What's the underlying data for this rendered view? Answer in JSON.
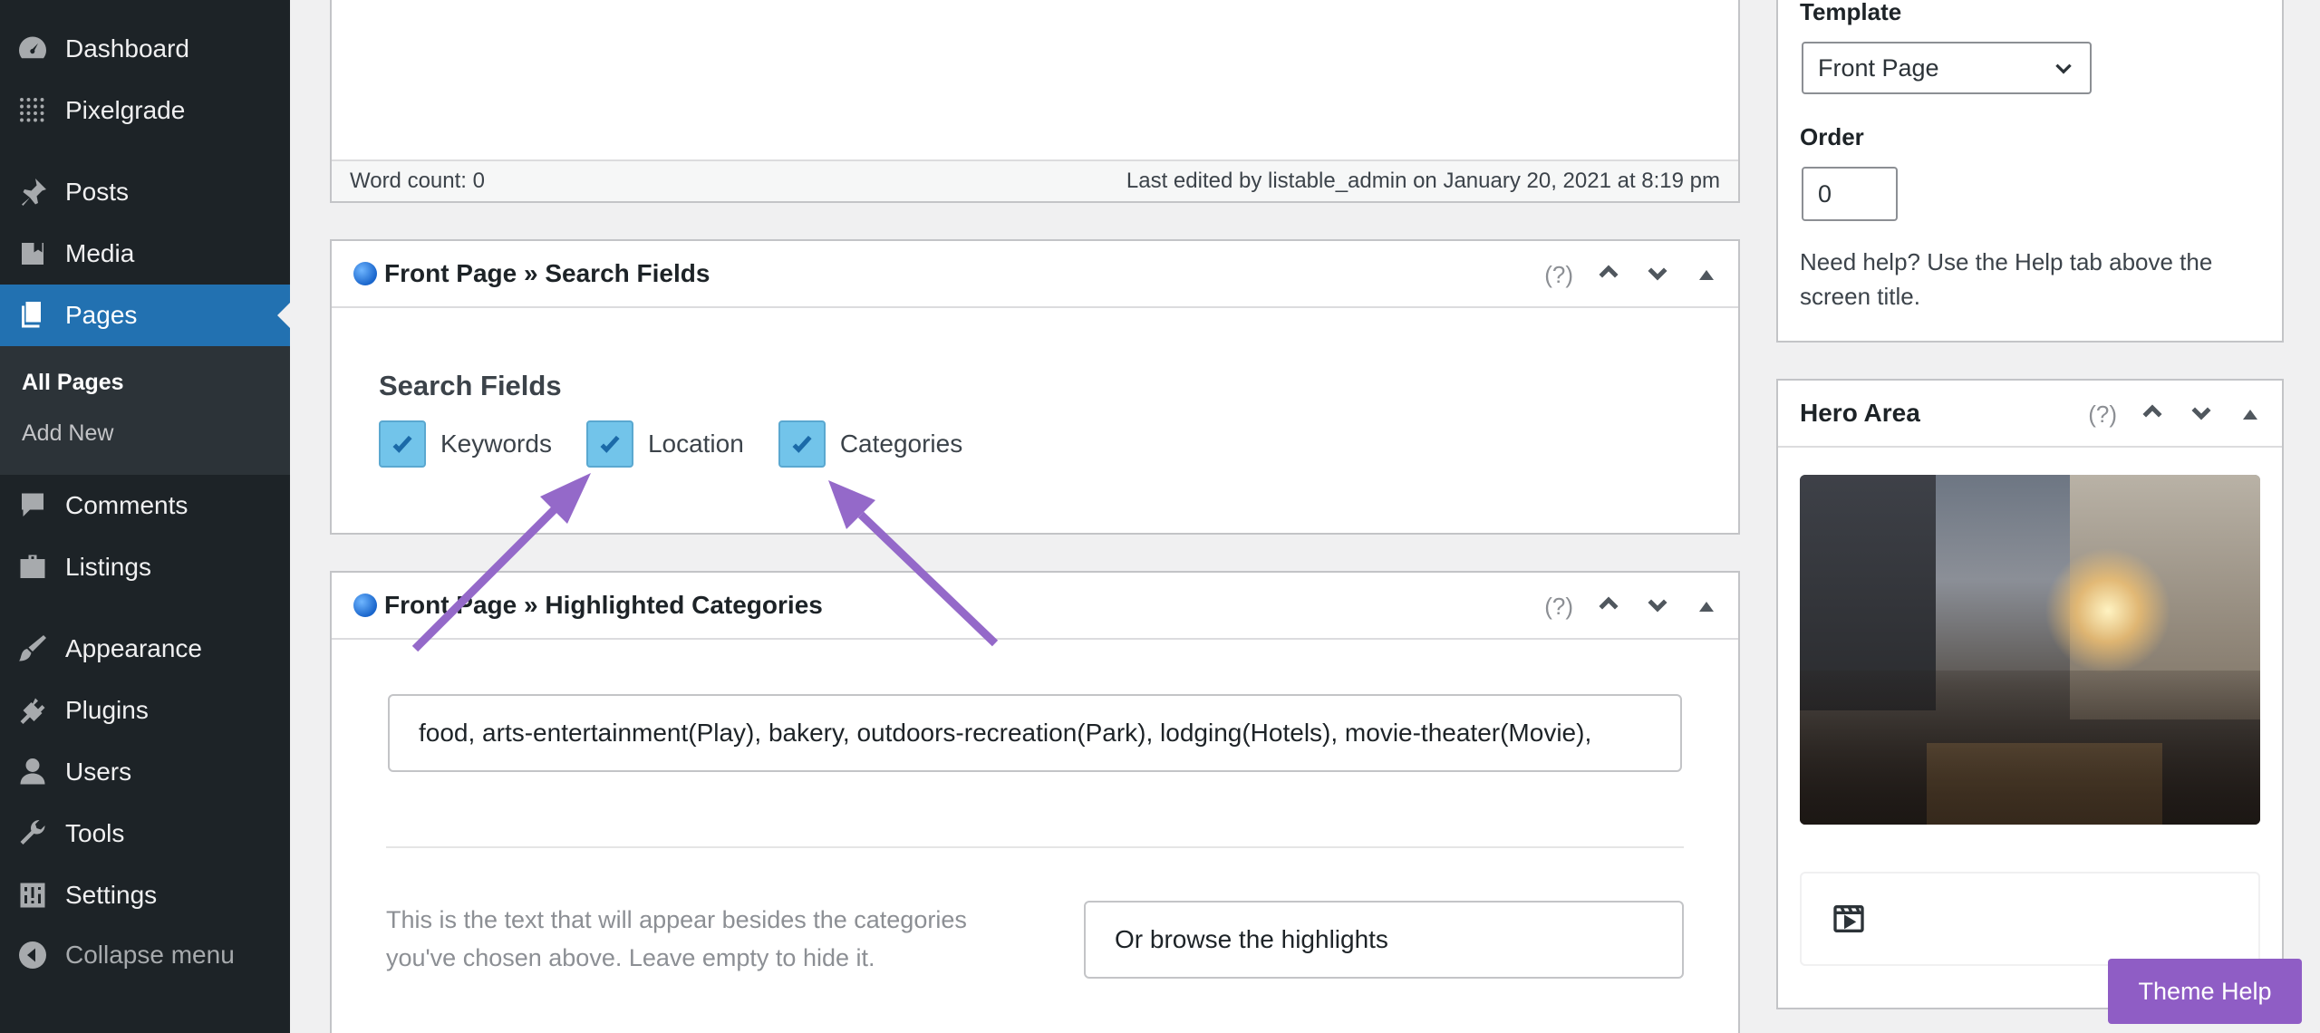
{
  "sidebar": {
    "items": [
      {
        "label": "Dashboard",
        "icon": "dashboard-icon"
      },
      {
        "label": "Pixelgrade",
        "icon": "grid-dots-icon"
      },
      {
        "label": "Posts",
        "icon": "pushpin-icon"
      },
      {
        "label": "Media",
        "icon": "media-icon"
      },
      {
        "label": "Pages",
        "icon": "pages-icon"
      },
      {
        "label": "Comments",
        "icon": "comment-icon"
      },
      {
        "label": "Listings",
        "icon": "briefcase-icon"
      },
      {
        "label": "Appearance",
        "icon": "paintbrush-icon"
      },
      {
        "label": "Plugins",
        "icon": "plug-icon"
      },
      {
        "label": "Users",
        "icon": "user-icon"
      },
      {
        "label": "Tools",
        "icon": "wrench-icon"
      },
      {
        "label": "Settings",
        "icon": "sliders-icon"
      }
    ],
    "submenu": [
      "All Pages",
      "Add New"
    ],
    "collapse_label": "Collapse menu",
    "active_color": "#2271b1"
  },
  "editor_footer": {
    "word_count": "Word count: 0",
    "last_edited": "Last edited by listable_admin on January 20, 2021 at 8:19 pm"
  },
  "search_fields_box": {
    "title": "Front Page » Search Fields",
    "help": "(?)",
    "heading": "Search Fields",
    "options": [
      {
        "label": "Keywords",
        "checked": true
      },
      {
        "label": "Location",
        "checked": true
      },
      {
        "label": "Categories",
        "checked": true
      }
    ]
  },
  "highlighted_box": {
    "title": "Front Page » Highlighted Categories",
    "help": "(?)",
    "categories_value": "food, arts-entertainment(Play), bakery, outdoors-recreation(Park), lodging(Hotels), movie-theater(Movie),",
    "description": "This is the text that will appear besides the categories you've chosen above. Leave empty to hide it.",
    "browse_value": "Or browse the highlights"
  },
  "page_attributes": {
    "template_label": "Template",
    "template_value": "Front Page",
    "order_label": "Order",
    "order_value": "0",
    "help_text": "Need help? Use the Help tab above the screen title."
  },
  "hero_area": {
    "title": "Hero Area",
    "help": "(?)",
    "media_icon": "video-icon"
  },
  "theme_help": {
    "label": "Theme Help",
    "color": "#8f5dc5"
  },
  "annotations": {
    "arrow_color": "#9469c9"
  }
}
